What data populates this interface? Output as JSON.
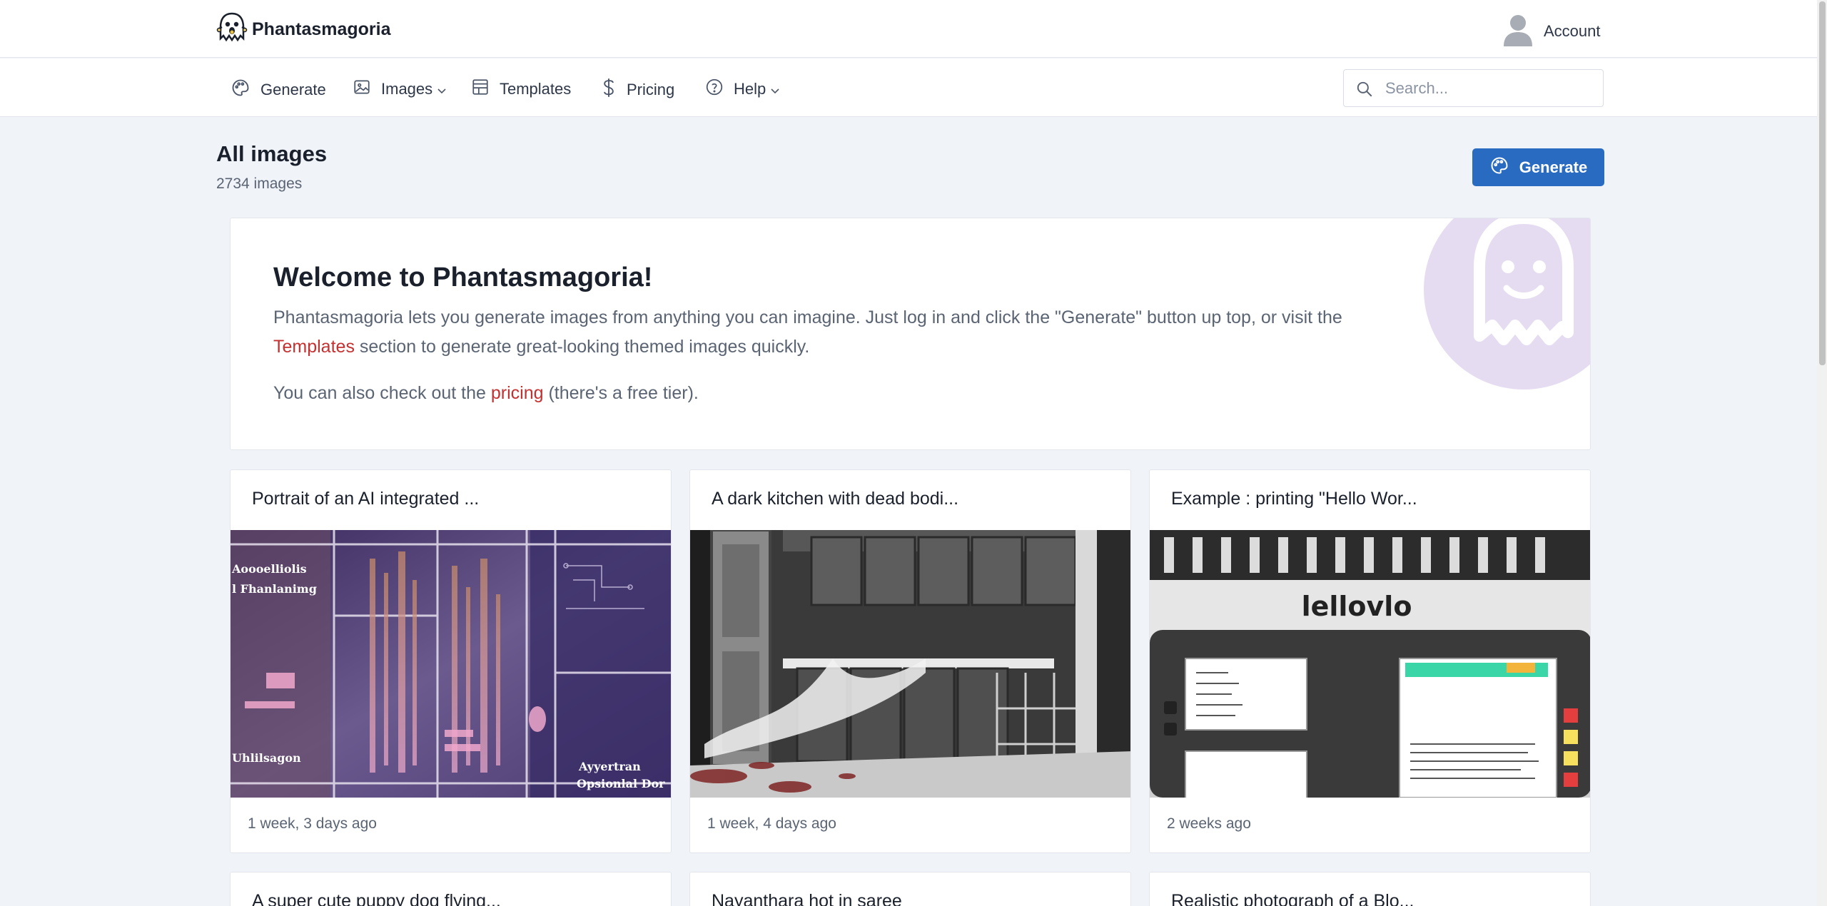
{
  "brand": {
    "name": "Phantasmagoria",
    "logo_icon": "ghost-icon"
  },
  "account": {
    "label": "Account",
    "avatar_icon": "user-avatar-icon"
  },
  "nav": {
    "items": [
      {
        "label": "Generate",
        "icon": "palette-icon"
      },
      {
        "label": "Images",
        "icon": "image-icon",
        "dropdown": true
      },
      {
        "label": "Templates",
        "icon": "template-icon"
      },
      {
        "label": "Pricing",
        "icon": "dollar-icon"
      },
      {
        "label": "Help",
        "icon": "question-circle-icon",
        "dropdown": true
      }
    ],
    "search": {
      "placeholder": "Search...",
      "value": ""
    }
  },
  "page": {
    "title": "All images",
    "count": "2734 images",
    "generate_label": "Generate"
  },
  "welcome": {
    "title": "Welcome to Phantasmagoria!",
    "p1_a": "Phantasmagoria lets you generate images from anything you can imagine. Just log in and click the \"Generate\" button up top, or visit the ",
    "p1_link": "Templates",
    "p1_b": " section to generate great-looking themed images quickly.",
    "p2_a": "You can also check out the ",
    "p2_link": "pricing",
    "p2_b": " (there's a free tier)."
  },
  "cards": [
    {
      "title": "Portrait of an AI integrated ...",
      "date": "1 week, 3 days ago"
    },
    {
      "title": "A dark kitchen with dead bodi...",
      "date": "1 week, 4 days ago"
    },
    {
      "title": "Example : printing \"Hello Wor...",
      "date": "2 weeks ago"
    }
  ],
  "cards_row2": [
    {
      "title": "A super cute puppy dog flying..."
    },
    {
      "title": "Nayanthara hot in saree"
    },
    {
      "title": "Realistic photograph of a Blo..."
    }
  ],
  "card_images": [
    {
      "caption_a": "Aoooelliolis",
      "caption_b": "l Fhanlanimg",
      "caption_c": "Uhlilsagon",
      "caption_d": "Ayyertran",
      "caption_e": "Opsionlal Dor"
    },
    {},
    {
      "caption": "lellovlo"
    }
  ]
}
